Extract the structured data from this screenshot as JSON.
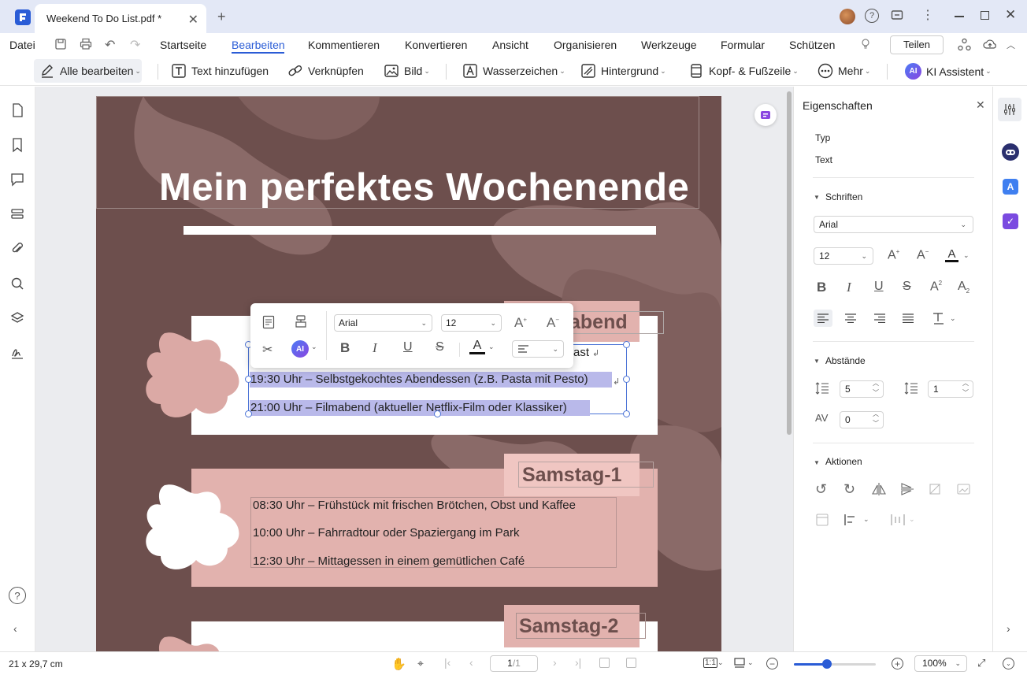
{
  "tab": {
    "title": "Weekend To Do List.pdf *"
  },
  "menu": {
    "file": "Datei",
    "items": [
      "Startseite",
      "Bearbeiten",
      "Kommentieren",
      "Konvertieren",
      "Ansicht",
      "Organisieren",
      "Werkzeuge",
      "Formular",
      "Schützen"
    ],
    "share": "Teilen"
  },
  "toolbar": {
    "edit_all": "Alle bearbeiten",
    "add_text": "Text hinzufügen",
    "link": "Verknüpfen",
    "image": "Bild",
    "watermark": "Wasserzeichen",
    "background": "Hintergrund",
    "header_footer": "Kopf- & Fußzeile",
    "more": "Mehr",
    "ai": "KI Assistent"
  },
  "document": {
    "title": "Mein perfektes Wochenende",
    "section1_heading_partial": "abend",
    "section1_line0_partial": "ast",
    "section1_lines": [
      "19:30 Uhr – Selbstgekochtes Abendessen (z.B. Pasta mit Pesto)",
      "21:00 Uhr – Filmabend (aktueller Netflix-Film oder Klassiker)"
    ],
    "section2_heading": "Samstag-1",
    "section2_lines": [
      "08:30 Uhr – Frühstück mit frischen Brötchen, Obst und Kaffee",
      "10:00 Uhr – Fahrradtour oder Spaziergang im Park",
      "12:30 Uhr – Mittagessen in einem gemütlichen Café"
    ],
    "section3_heading": "Samstag-2"
  },
  "floating_toolbar": {
    "font": "Arial",
    "size": "12",
    "ai": "AI"
  },
  "properties": {
    "title": "Eigenschaften",
    "type_label": "Typ",
    "type_value": "Text",
    "fonts_label": "Schriften",
    "font": "Arial",
    "size": "12",
    "spacing_label": "Abstände",
    "line_spacing": "5",
    "para_spacing": "1",
    "char_spacing": "0",
    "actions_label": "Aktionen"
  },
  "status": {
    "page_size": "21 x 29,7 cm",
    "page_current": "1",
    "page_total": "/1",
    "zoom": "100%"
  },
  "colors": {
    "accent": "#2a5cd6",
    "page_bg": "#6d4f4d",
    "pink": "#e2b2ae",
    "selection": "#b9b9ea",
    "heading_text": "#6d4f4d"
  }
}
